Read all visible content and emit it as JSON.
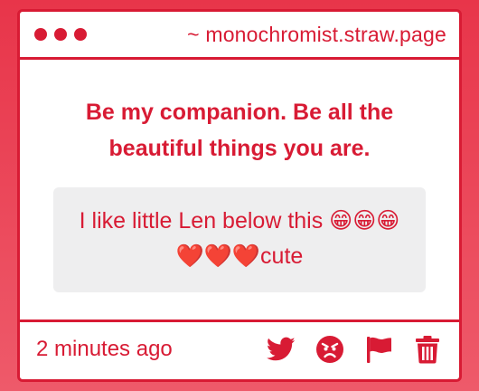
{
  "window": {
    "site_label": "~ monochromist.straw.page"
  },
  "question": {
    "text": "Be my companion. Be all the beautiful things you are."
  },
  "answer": {
    "text": "I like little Len below this 😁😁😁❤️❤️❤️cute"
  },
  "footer": {
    "timestamp": "2 minutes ago",
    "actions": [
      {
        "icon": "twitter-icon"
      },
      {
        "icon": "angry-face-icon"
      },
      {
        "icon": "flag-icon"
      },
      {
        "icon": "trash-icon"
      }
    ]
  },
  "colors": {
    "accent": "#d81b34",
    "background": "#e8354a",
    "answer_bg": "#eeeeef"
  }
}
